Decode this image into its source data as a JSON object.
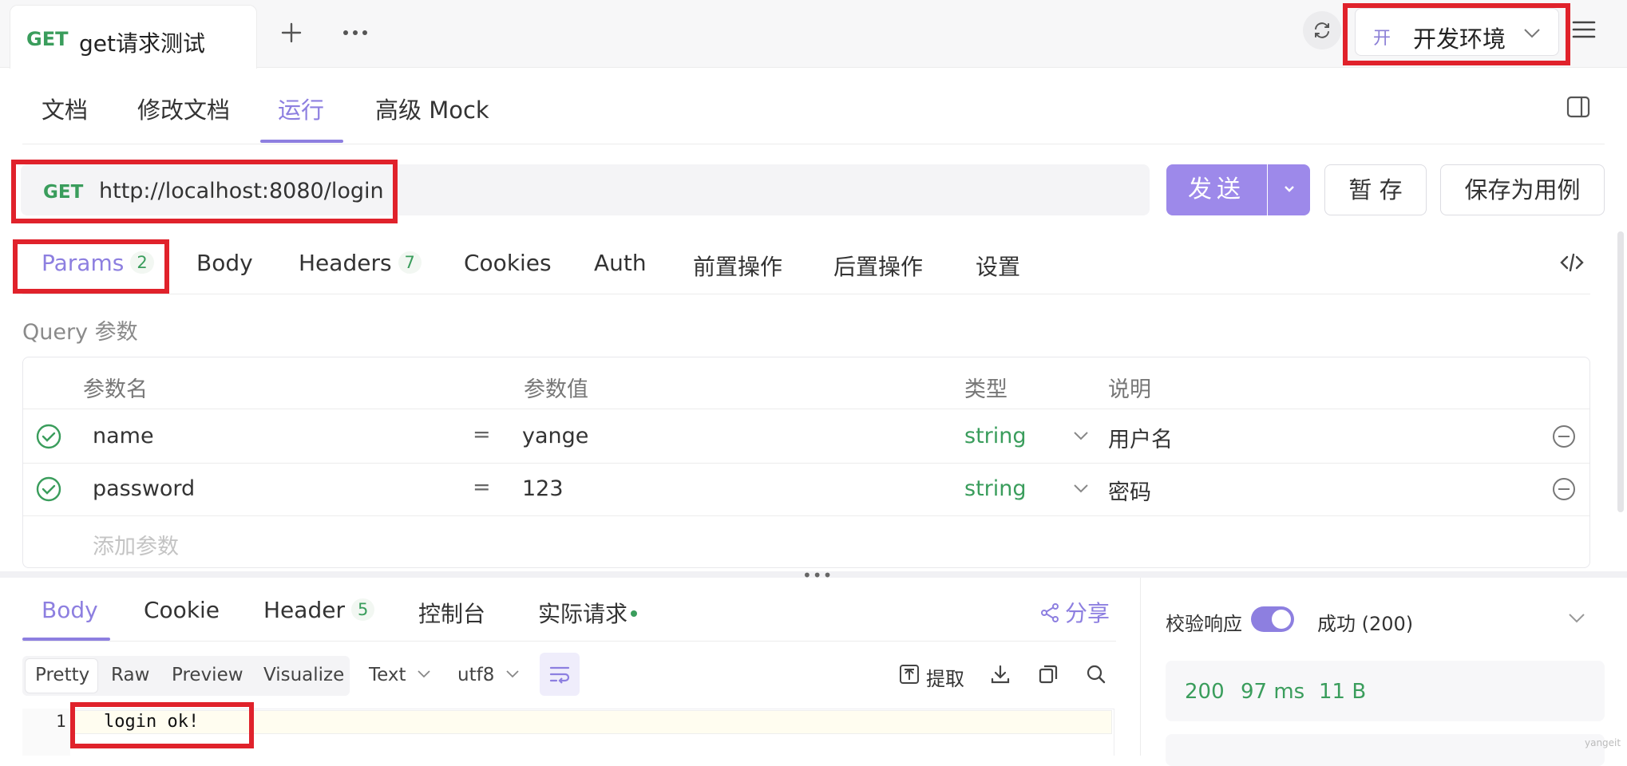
{
  "tabbar": {
    "active_tab": {
      "method": "GET",
      "title": "get请求测试"
    },
    "env": {
      "badge": "开",
      "label": "开发环境"
    }
  },
  "subtabs": [
    "文档",
    "修改文档",
    "运行",
    "高级 Mock"
  ],
  "request": {
    "method": "GET",
    "url": "http://localhost:8080/login",
    "send_label": "发送",
    "save_temp_label": "暂 存",
    "save_case_label": "保存为用例"
  },
  "req_tabs": {
    "params": {
      "label": "Params",
      "count": "2"
    },
    "body": "Body",
    "headers": {
      "label": "Headers",
      "count": "7"
    },
    "cookies": "Cookies",
    "auth": "Auth",
    "pre": "前置操作",
    "post": "后置操作",
    "settings": "设置"
  },
  "query": {
    "label": "Query 参数",
    "headers": [
      "参数名",
      "参数值",
      "类型",
      "说明"
    ],
    "rows": [
      {
        "name": "name",
        "eq": "=",
        "value": "yange",
        "type": "string",
        "desc": "用户名"
      },
      {
        "name": "password",
        "eq": "=",
        "value": "123",
        "type": "string",
        "desc": "密码"
      }
    ],
    "add_placeholder": "添加参数"
  },
  "response": {
    "tabs": {
      "body": "Body",
      "cookie": "Cookie",
      "header": {
        "label": "Header",
        "count": "5"
      },
      "console": "控制台",
      "actual": "实际请求"
    },
    "share": "分享",
    "views": [
      "Pretty",
      "Raw",
      "Preview",
      "Visualize"
    ],
    "format": "Text",
    "encoding": "utf8",
    "extract": "提取",
    "code": {
      "line": "1",
      "text": "login ok!"
    },
    "verify_label": "校验响应",
    "success_label": "成功 (200)",
    "stats": {
      "status": "200",
      "time": "97 ms",
      "size": "11 B"
    }
  },
  "watermark": "yangeit",
  "colors": {
    "accent": "#8d7fe0",
    "method": "#3a9d5c",
    "highlight": "#e0222b"
  }
}
